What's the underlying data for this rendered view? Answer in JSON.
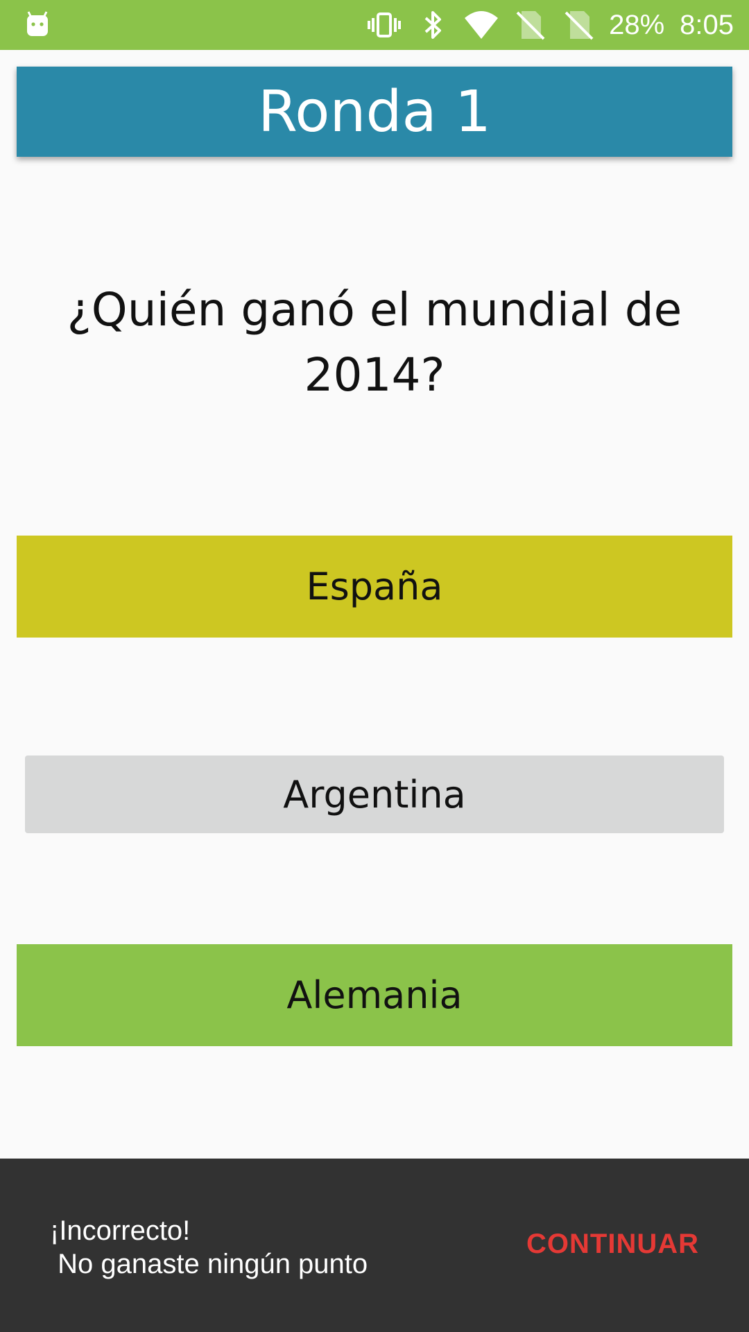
{
  "status_bar": {
    "battery": "28%",
    "time": "8:05",
    "left_icon": "android-icon",
    "icons": [
      "vibrate-icon",
      "bluetooth-icon",
      "wifi-icon",
      "no-sim-icon",
      "no-sim-icon"
    ]
  },
  "header": {
    "title": "Ronda 1",
    "color": "#2a89a8"
  },
  "question": {
    "text": "¿Quién ganó el mundial de 2014?"
  },
  "answers": [
    {
      "label": "España",
      "color": "#cdc722"
    },
    {
      "label": "Argentina",
      "color": "#d7d8d8"
    },
    {
      "label": "Alemania",
      "color": "#8bc34a"
    }
  ],
  "snackbar": {
    "message": "¡Incorrecto!\n No ganaste ningún punto",
    "action": "CONTINUAR",
    "action_color": "#e53935"
  }
}
